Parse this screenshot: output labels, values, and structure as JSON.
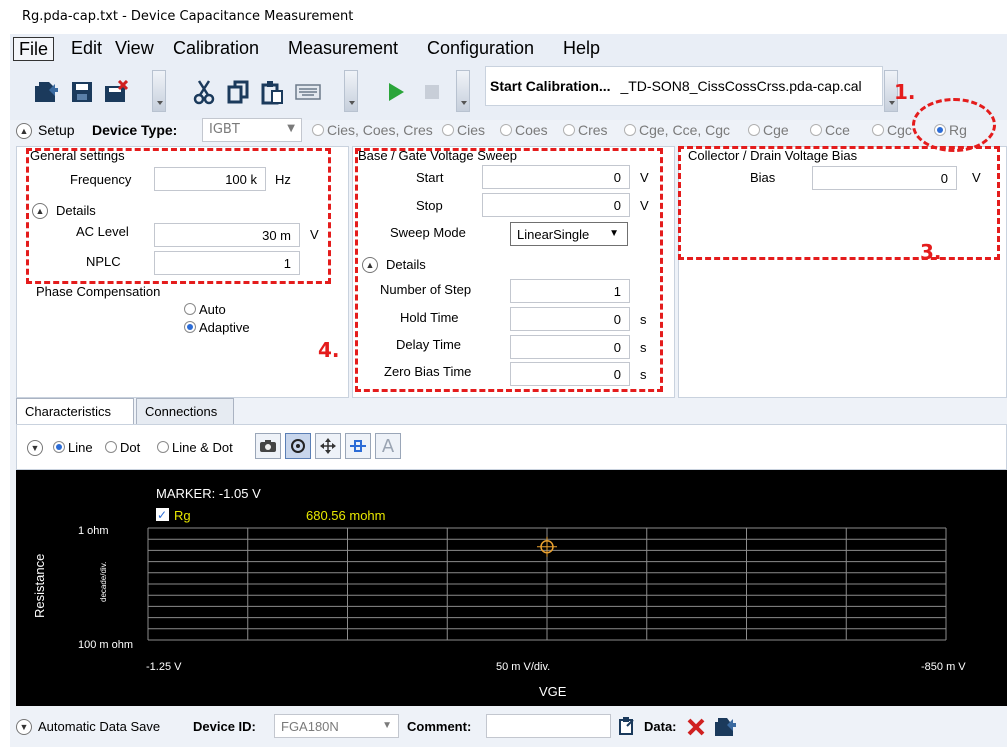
{
  "window": {
    "title": "Rg.pda-cap.txt - Device Capacitance Measurement"
  },
  "menu": [
    "File",
    "Edit",
    "View",
    "Calibration",
    "Measurement",
    "Configuration",
    "Help"
  ],
  "toolbar": {
    "icons": [
      "open-icon",
      "save-icon",
      "save-delete-icon",
      "cut-icon",
      "copy-icon",
      "paste-icon",
      "keyboard-icon",
      "run-icon",
      "stop-icon"
    ],
    "start_calibration_label": "Start Calibration...",
    "calibration_file": "_TD-SON8_CissCossCrss.pda-cap.cal"
  },
  "setup": {
    "label": "Setup",
    "device_type_label": "Device Type:",
    "device_type_value": "IGBT",
    "modes": [
      "Cies, Coes, Cres",
      "Cies",
      "Coes",
      "Cres",
      "Cge, Cce, Cgc",
      "Cge",
      "Cce",
      "Cgc",
      "Rg"
    ],
    "selected_mode": "Rg"
  },
  "general": {
    "title": "General settings",
    "frequency_label": "Frequency",
    "frequency_value": "100 k",
    "frequency_unit": "Hz",
    "details_label": "Details",
    "ac_level_label": "AC Level",
    "ac_level_value": "30 m",
    "ac_level_unit": "V",
    "nplc_label": "NPLC",
    "nplc_value": "1",
    "phase_comp_label": "Phase Compensation",
    "phase_options": [
      "Auto",
      "Adaptive"
    ],
    "phase_selected": "Adaptive"
  },
  "sweep": {
    "title": "Base / Gate Voltage Sweep",
    "start_label": "Start",
    "start_value": "0",
    "start_unit": "V",
    "stop_label": "Stop",
    "stop_value": "0",
    "stop_unit": "V",
    "mode_label": "Sweep Mode",
    "mode_value": "LinearSingle",
    "details_label": "Details",
    "steps_label": "Number of Step",
    "steps_value": "1",
    "hold_label": "Hold Time",
    "hold_value": "0",
    "hold_unit": "s",
    "delay_label": "Delay Time",
    "delay_value": "0",
    "delay_unit": "s",
    "zero_bias_label": "Zero Bias Time",
    "zero_bias_value": "0",
    "zero_bias_unit": "s"
  },
  "bias": {
    "title": "Collector / Drain Voltage Bias",
    "bias_label": "Bias",
    "bias_value": "0",
    "bias_unit": "V"
  },
  "annotations": {
    "n1": "1.",
    "n3": "3.",
    "n4": "4."
  },
  "tabs": [
    "Characteristics",
    "Connections"
  ],
  "chart_tools": {
    "plot_modes": [
      "Line",
      "Dot",
      "Line & Dot"
    ],
    "selected_mode": "Line",
    "buttons": [
      "camera-icon",
      "target-icon",
      "move-icon",
      "marker-icon",
      "text-a-icon"
    ]
  },
  "chart_data": {
    "type": "line",
    "marker_label": "MARKER: -1.05 V",
    "series": [
      {
        "name": "Rg",
        "color": "#e8e800",
        "x": [
          -1.05
        ],
        "y": [
          0.68056
        ]
      }
    ],
    "marker_readout": "680.56 mohm",
    "ylabel": "Resistance",
    "y_scale_label": "decade/div.",
    "ytick_top": "1 ohm",
    "ytick_bottom": "100 m ohm",
    "xtick_left": "-1.25  V",
    "xtick_right": "-850 m  V",
    "x_div_label": "50 m V/div.",
    "xlabel": "VGE",
    "xlim": [
      -1.25,
      -0.85
    ],
    "ylim": [
      0.1,
      1
    ],
    "y_log": true,
    "grid": true,
    "marker_x": -1.05,
    "colors": {
      "background": "#000000",
      "grid": "#8c8c8c",
      "marker": "#e8a030",
      "series": "#e8e800"
    }
  },
  "bottom": {
    "auto_save_label": "Automatic Data Save",
    "device_id_label": "Device ID:",
    "device_id_value": "FGA180N",
    "comment_label": "Comment:",
    "comment_value": "",
    "data_label": "Data:"
  }
}
